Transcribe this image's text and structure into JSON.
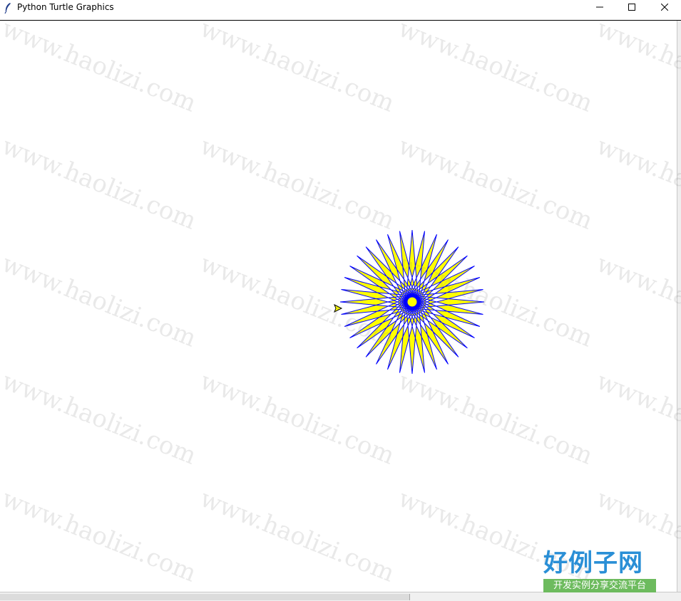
{
  "window": {
    "title": "Python Turtle Graphics",
    "icons": {
      "app": "feather-icon",
      "minimize": "minimize-icon",
      "maximize": "maximize-icon",
      "close": "close-icon"
    }
  },
  "drawing": {
    "shape": "star",
    "points": 36,
    "fill_color": "#ffff00",
    "pen_color": "#0000ff",
    "turtle_color": "#000000",
    "turtle_fill": "#ffff00"
  },
  "watermark": {
    "text": "www.haolizi.com",
    "logo_main": "好例子网",
    "logo_sub": "开发实例分享交流平台",
    "logo_main_color": "#2a8fd6",
    "logo_sub_bg": "#6dbb5e"
  }
}
